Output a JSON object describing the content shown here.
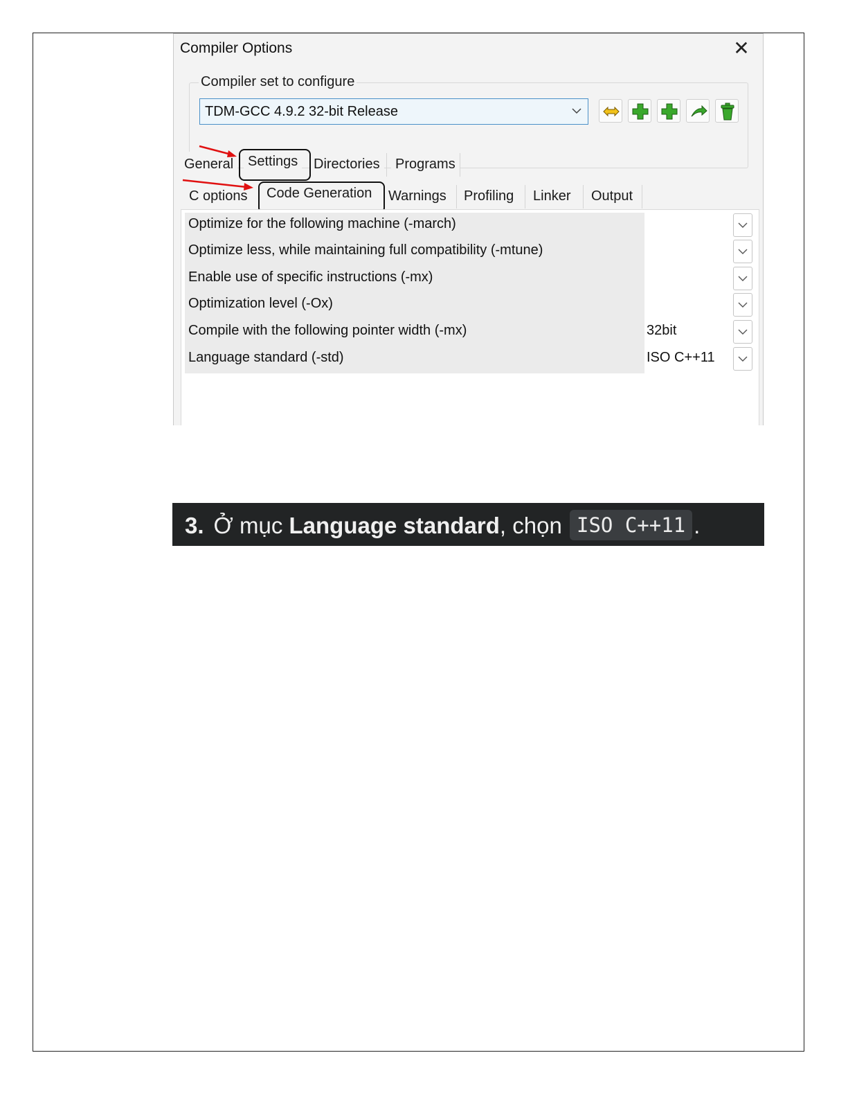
{
  "dialog": {
    "title": "Compiler Options",
    "close_glyph": "✕",
    "compiler_set": {
      "legend": "Compiler set to configure",
      "selected": "TDM-GCC 4.9.2 32-bit Release"
    },
    "toolbar_icons": [
      "rename-icon",
      "add-icon",
      "add-icon",
      "find-icon",
      "delete-icon"
    ],
    "tabs": [
      "General",
      "Settings",
      "Directories",
      "Programs"
    ],
    "active_tab": "Settings",
    "subtabs": [
      "C options",
      "Code Generation",
      "Warnings",
      "Profiling",
      "Linker",
      "Output"
    ],
    "active_subtab": "Code Generation",
    "options": [
      {
        "label": "Optimize for the following machine (-march)",
        "value": ""
      },
      {
        "label": "Optimize less, while maintaining full compatibility (-mtune)",
        "value": ""
      },
      {
        "label": "Enable use of specific instructions (-mx)",
        "value": ""
      },
      {
        "label": "Optimization level (-Ox)",
        "value": ""
      },
      {
        "label": "Compile with the following pointer width (-mx)",
        "value": "32bit"
      },
      {
        "label": "Language standard (-std)",
        "value": "ISO C++11"
      }
    ]
  },
  "instruction": {
    "number": "3.",
    "prefix": "Ở mục",
    "strong": "Language standard",
    "middle": ", chọn",
    "code": "ISO C++11",
    "suffix": "."
  },
  "colors": {
    "combo_border": "#4a90c8",
    "arrow_red": "#e01010",
    "banner_bg": "#222425",
    "icon_green": "#3aa82c",
    "icon_yellow": "#f2c21a"
  }
}
